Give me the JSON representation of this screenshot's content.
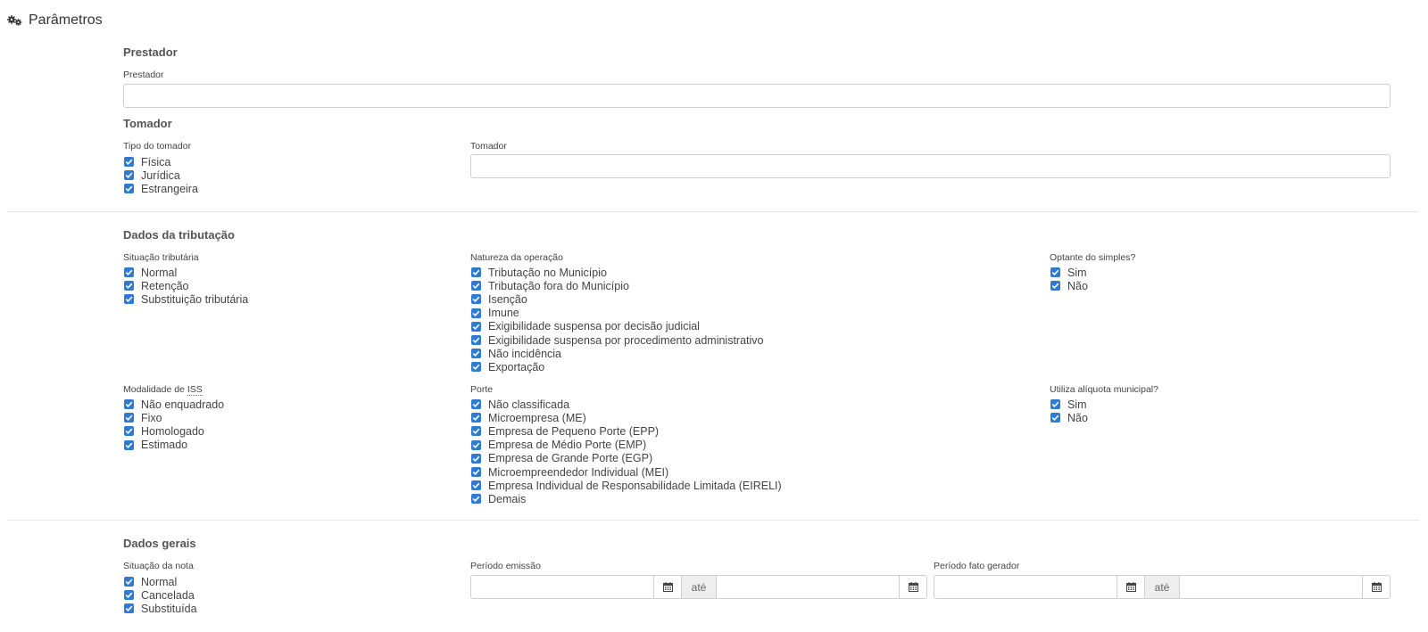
{
  "page": {
    "title": "Parâmetros",
    "icon": "gears-icon"
  },
  "prestador": {
    "section_title": "Prestador",
    "field_label": "Prestador",
    "value": ""
  },
  "tomador": {
    "section_title": "Tomador",
    "tipo_label": "Tipo do tomador",
    "tipo_options": [
      {
        "label": "Física",
        "checked": true
      },
      {
        "label": "Jurídica",
        "checked": true
      },
      {
        "label": "Estrangeira",
        "checked": true
      }
    ],
    "field_label": "Tomador",
    "value": ""
  },
  "tributacao": {
    "section_title": "Dados da tributação",
    "situacao": {
      "label": "Situação tributária",
      "options": [
        {
          "label": "Normal",
          "checked": true
        },
        {
          "label": "Retenção",
          "checked": true
        },
        {
          "label": "Substituição tributária",
          "checked": true
        }
      ]
    },
    "natureza": {
      "label": "Natureza da operação",
      "options": [
        {
          "label": "Tributação no Município",
          "checked": true
        },
        {
          "label": "Tributação fora do Município",
          "checked": true
        },
        {
          "label": "Isenção",
          "checked": true
        },
        {
          "label": "Imune",
          "checked": true
        },
        {
          "label": "Exigibilidade suspensa por decisão judicial",
          "checked": true
        },
        {
          "label": "Exigibilidade suspensa por procedimento administrativo",
          "checked": true
        },
        {
          "label": "Não incidência",
          "checked": true
        },
        {
          "label": "Exportação",
          "checked": true
        }
      ]
    },
    "optante": {
      "label": "Optante do simples?",
      "options": [
        {
          "label": "Sim",
          "checked": true
        },
        {
          "label": "Não",
          "checked": true
        }
      ]
    },
    "modalidade": {
      "label_prefix": "Modalidade de ",
      "label_abbr": "ISS",
      "options": [
        {
          "label": "Não enquadrado",
          "checked": true
        },
        {
          "label": "Fixo",
          "checked": true
        },
        {
          "label": "Homologado",
          "checked": true
        },
        {
          "label": "Estimado",
          "checked": true
        }
      ]
    },
    "porte": {
      "label": "Porte",
      "options": [
        {
          "label": "Não classificada",
          "checked": true
        },
        {
          "label": "Microempresa (ME)",
          "checked": true
        },
        {
          "label": "Empresa de Pequeno Porte (EPP)",
          "checked": true
        },
        {
          "label": "Empresa de Médio Porte (EMP)",
          "checked": true
        },
        {
          "label": "Empresa de Grande Porte (EGP)",
          "checked": true
        },
        {
          "label": "Microempreendedor Individual (MEI)",
          "checked": true
        },
        {
          "label": "Empresa Individual de Responsabilidade Limitada (EIRELI)",
          "checked": true
        },
        {
          "label": "Demais",
          "checked": true
        }
      ]
    },
    "aliquota": {
      "label": "Utiliza alíquota municipal?",
      "options": [
        {
          "label": "Sim",
          "checked": true
        },
        {
          "label": "Não",
          "checked": true
        }
      ]
    }
  },
  "gerais": {
    "section_title": "Dados gerais",
    "situacao_nota": {
      "label": "Situação da nota",
      "options": [
        {
          "label": "Normal",
          "checked": true
        },
        {
          "label": "Cancelada",
          "checked": true
        },
        {
          "label": "Substituída",
          "checked": true
        }
      ]
    },
    "periodo_emissao": {
      "label": "Período emissão",
      "separator": "até",
      "from": "",
      "to": "",
      "icon": "calendar-icon"
    },
    "periodo_fato": {
      "label": "Período fato gerador",
      "separator": "até",
      "from": "",
      "to": "",
      "icon": "calendar-icon"
    }
  },
  "colors": {
    "checkbox": "#2f7bd1",
    "border": "#cfcfcf",
    "divider": "#e6e6e6"
  }
}
